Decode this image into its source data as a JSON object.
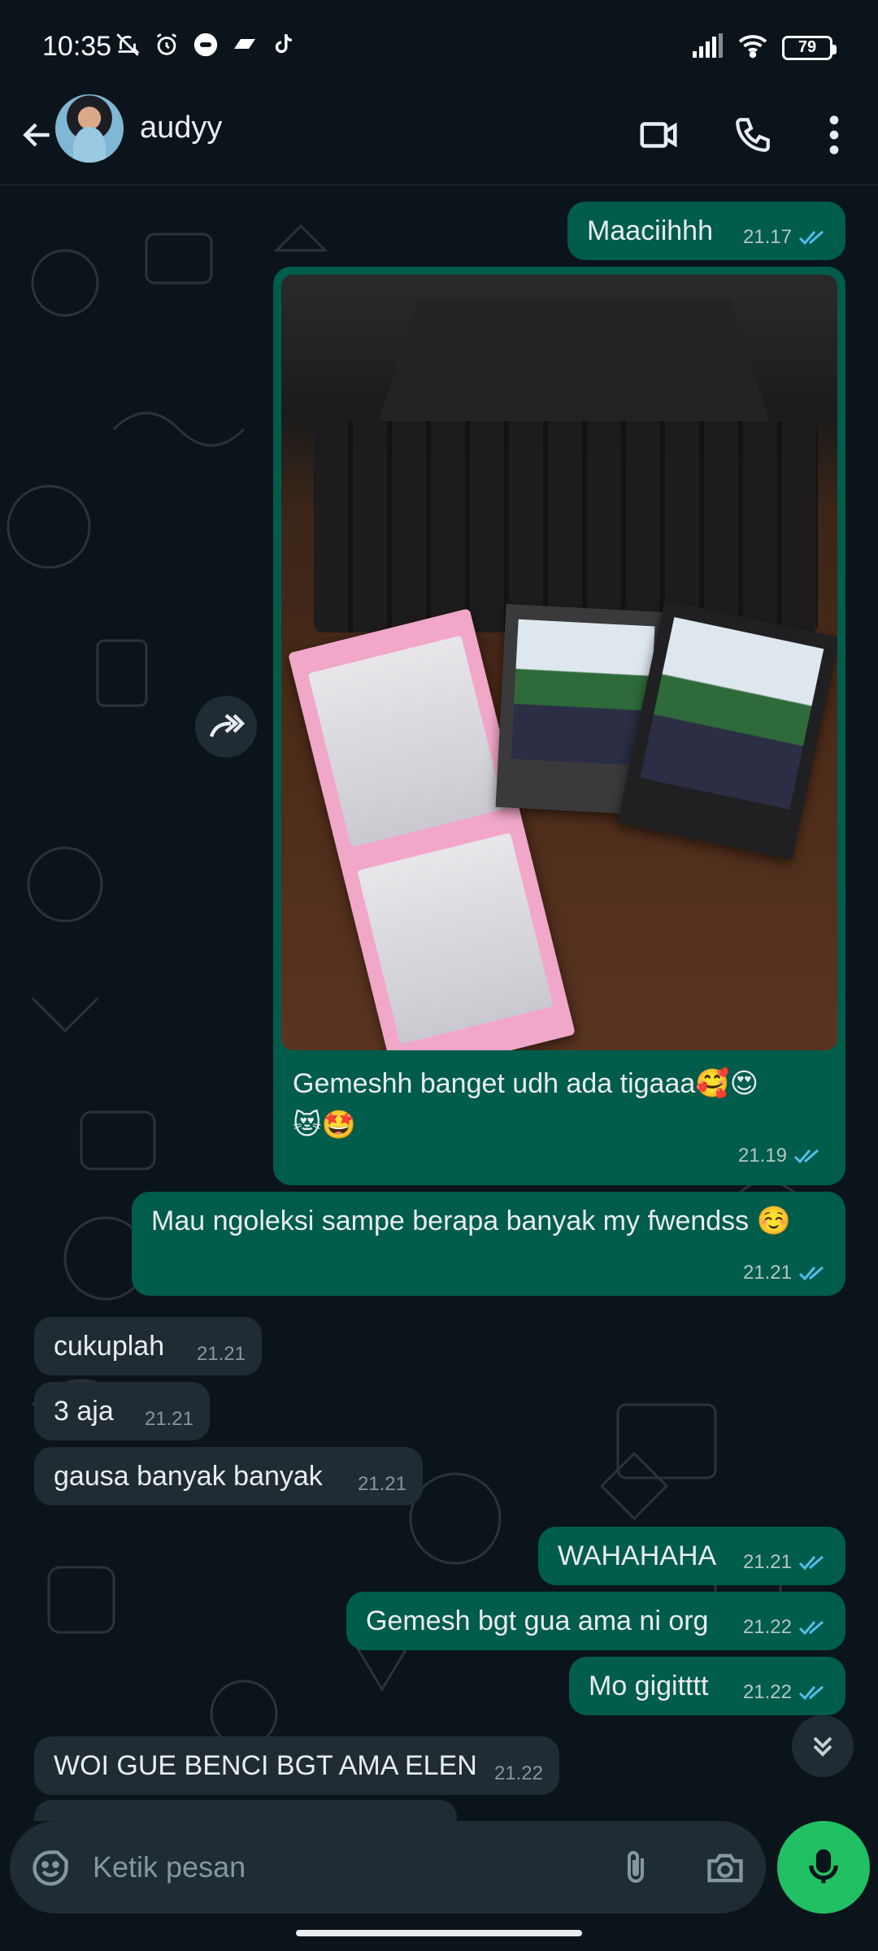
{
  "status_bar": {
    "time": "10:35",
    "battery": "79"
  },
  "header": {
    "contact_name": "audyy"
  },
  "messages": {
    "m1": {
      "text": "Maaciihhh",
      "time": "21.17"
    },
    "photo": {
      "caption_line1": "Gemeshh banget udh ada tigaaa🥰😍",
      "caption_line2": "😻🤩",
      "time": "21.19"
    },
    "m3": {
      "text": "Mau ngoleksi sampe berapa banyak my fwendss ☺️",
      "time": "21.21"
    },
    "in1": {
      "text": "cukuplah",
      "time": "21.21"
    },
    "in2": {
      "text": "3 aja",
      "time": "21.21"
    },
    "in3": {
      "text": "gausa banyak banyak",
      "time": "21.21"
    },
    "m4": {
      "text": "WAHAHAHA",
      "time": "21.21"
    },
    "m5": {
      "text": "Gemesh bgt gua ama ni org",
      "time": "21.22"
    },
    "m6": {
      "text": "Mo gigitttt",
      "time": "21.22"
    },
    "in4": {
      "text": "WOI GUE BENCI BGT AMA ELEN",
      "time": "21.22"
    }
  },
  "composer": {
    "placeholder": "Ketik pesan"
  },
  "colors": {
    "outgoing": "#005c4b",
    "incoming": "#202c33",
    "accent": "#21c063",
    "read_ticks": "#53bdeb"
  }
}
